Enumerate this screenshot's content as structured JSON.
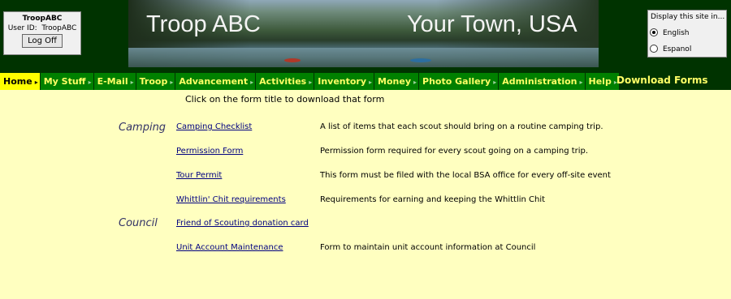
{
  "login": {
    "site_name": "TroopABC",
    "user_id_label": "User ID:",
    "user_id": "TroopABC",
    "logoff_label": "Log Off"
  },
  "banner": {
    "title": "Troop ABC",
    "town": "Your Town, USA"
  },
  "language": {
    "heading": "Display this site in...",
    "options": [
      {
        "label": "English",
        "selected": true
      },
      {
        "label": "Espanol",
        "selected": false
      }
    ]
  },
  "menu": {
    "items": [
      {
        "label": "Home",
        "active": true
      },
      {
        "label": "My Stuff"
      },
      {
        "label": "E-Mail"
      },
      {
        "label": "Troop"
      },
      {
        "label": "Advancement"
      },
      {
        "label": "Activities"
      },
      {
        "label": "Inventory"
      },
      {
        "label": "Money"
      },
      {
        "label": "Photo Gallery"
      },
      {
        "label": "Administration"
      },
      {
        "label": "Help"
      }
    ],
    "arrow": "▸"
  },
  "page": {
    "title": "Download Forms",
    "instruction": "Click on the form title to download that form"
  },
  "forms": [
    {
      "category": "Camping",
      "title": "Camping Checklist",
      "description": "A list of items that each scout should bring on a routine camping trip."
    },
    {
      "category": "",
      "title": "Permission Form",
      "description": "Permission form required for every scout going on a camping trip."
    },
    {
      "category": "",
      "title": "Tour Permit",
      "description": "This form must be filed with the local BSA office for every off-site event"
    },
    {
      "category": "",
      "title": "Whittlin' Chit requirements",
      "description": "Requirements for earning and keeping the Whittlin Chit"
    },
    {
      "category": "Council",
      "title": "Friend of Scouting donation card",
      "description": ""
    },
    {
      "category": "",
      "title": "Unit Account Maintenance",
      "description": "Form to maintain unit account information at Council"
    }
  ],
  "colors": {
    "header_bg": "#003300",
    "menu_bg": "#008000",
    "menu_text": "#ffff66",
    "menu_active_bg": "#ffff00",
    "page_bg": "#ffffc0",
    "link": "#000080"
  }
}
